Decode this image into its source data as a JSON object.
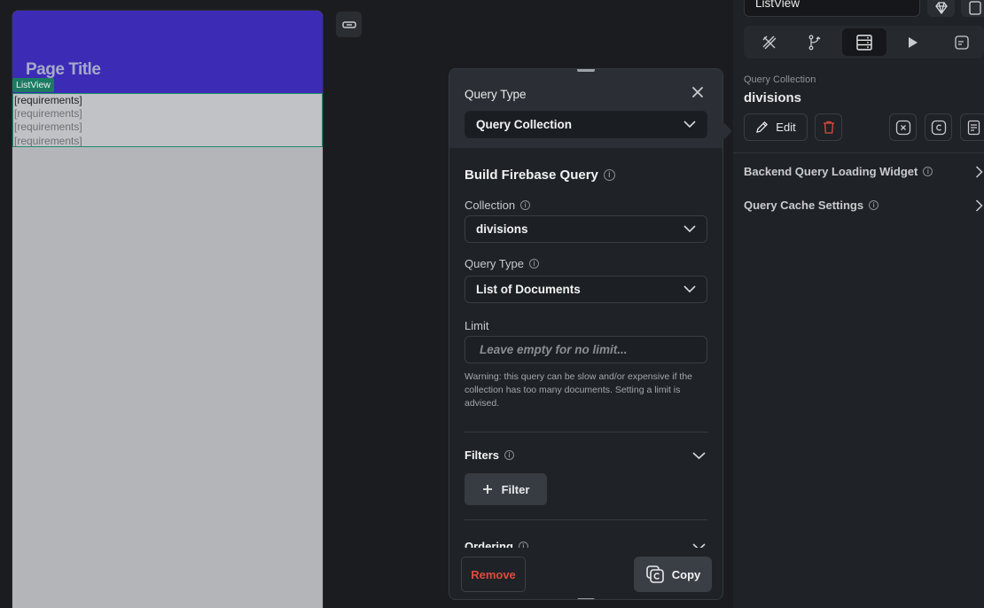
{
  "canvas": {
    "page_title": "Page Title",
    "listview_tag": "ListView",
    "list_items": [
      "[requirements]",
      "[requirements]",
      "[requirements]",
      "[requirements]"
    ]
  },
  "popup": {
    "title": "Query Type",
    "query_type_value": "Query Collection",
    "build_title": "Build Firebase Query",
    "collection_label": "Collection",
    "collection_value": "divisions",
    "query_type_label": "Query Type",
    "query_type_list_value": "List of Documents",
    "limit_label": "Limit",
    "limit_placeholder": "Leave empty for no limit...",
    "warning": "Warning: this query can be slow and/or expensive if the collection has too many documents. Setting a limit is advised.",
    "filters_label": "Filters",
    "filter_button": "Filter",
    "ordering_label": "Ordering",
    "remove_button": "Remove",
    "copy_button": "Copy"
  },
  "panel": {
    "widget_name": "ListView",
    "tabs": [
      "properties",
      "actions",
      "backend-query",
      "preview",
      "notes"
    ],
    "active_tab": "backend-query",
    "query_caption": "Query Collection",
    "query_name": "divisions",
    "edit_button": "Edit",
    "sections": [
      {
        "label": "Backend Query Loading Widget"
      },
      {
        "label": "Query Cache Settings"
      }
    ]
  },
  "colors": {
    "appbar": "#3b2bb5",
    "listview_border": "#1e8b6e",
    "danger": "#e24a3f",
    "popup_bg": "#1f2226"
  }
}
